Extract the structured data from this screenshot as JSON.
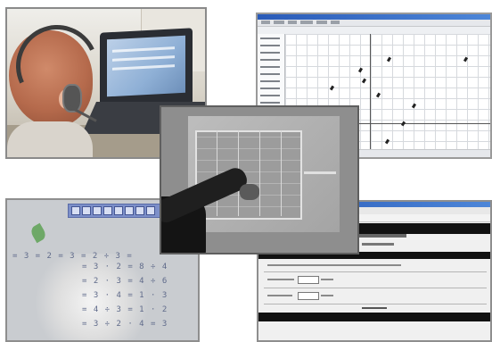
{
  "panels": [
    {
      "id": "student-headset-photo",
      "kind": "photo"
    },
    {
      "id": "graphing-software-screenshot",
      "kind": "screenshot"
    },
    {
      "id": "teacher-pointing-photo",
      "kind": "photo"
    },
    {
      "id": "whiteboard-equations-photo",
      "kind": "photo"
    },
    {
      "id": "web-form-screenshot",
      "kind": "screenshot"
    }
  ],
  "whiteboard": {
    "equations": [
      "= 3 = 2 = 3 = 2 ÷ 3 =",
      "= 3 · 2 = 8 ÷ 4",
      "= 2 · 3 = 4 ÷ 6",
      "= 3 · 4 = 1 · 3",
      "= 4 ÷ 3 = 1 · 2",
      "= 3 ÷ 2 · 4 = 3"
    ]
  },
  "colors": {
    "window_titlebar": "#2a5bb8",
    "whiteboard_toolbar": "#7c8fc9",
    "leaf_green": "#6ea867"
  }
}
